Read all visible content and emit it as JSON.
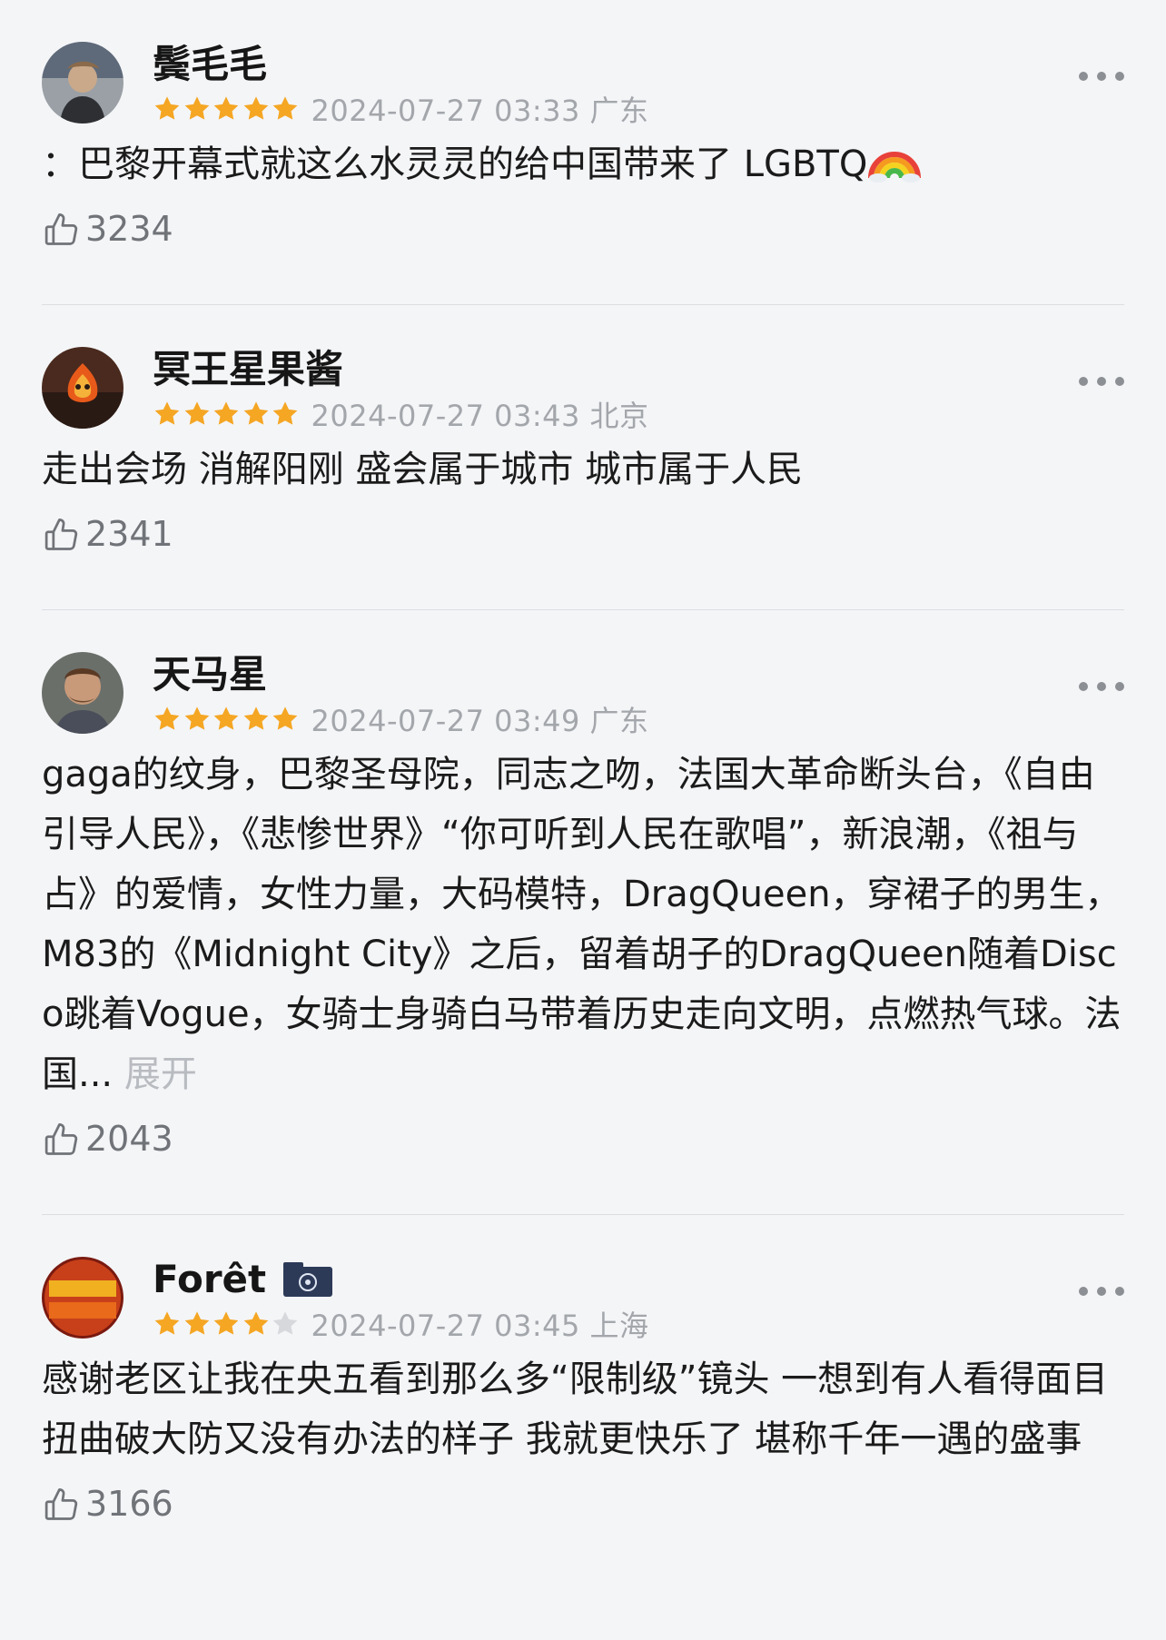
{
  "reviews": [
    {
      "username": "鬓毛毛",
      "rating": 5,
      "datetime": "2024-07-27 03:33",
      "location": "广东",
      "text": "：巴黎开幕式就这么水灵灵的给中国带来了 LGBTQ",
      "emoji": "rainbow-emoji",
      "likes": "3234"
    },
    {
      "username": "冥王星果酱",
      "rating": 5,
      "datetime": "2024-07-27 03:43",
      "location": "北京",
      "text": "走出会场 消解阳刚 盛会属于城市 城市属于人民",
      "likes": "2341"
    },
    {
      "username": "天马星",
      "rating": 5,
      "datetime": "2024-07-27 03:49",
      "location": "广东",
      "text": "gaga的纹身，巴黎圣母院，同志之吻，法国大革命断头台，《自由引导人民》，《悲惨世界》“你可听到人民在歌唱”，新浪潮，《祖与占》的爱情，女性力量，大码模特，DragQueen，穿裙子的男生，M83的《Midnight City》之后，留着胡子的DragQueen随着Disco跳着Vogue，女骑士身骑白马带着历史走向文明，点燃热气球。法国...",
      "expand_label": "展开",
      "likes": "2043"
    },
    {
      "username": "Forêt",
      "rating": 4,
      "datetime": "2024-07-27 03:45",
      "location": "上海",
      "text": "感谢老区让我在央五看到那么多“限制级”镜头 一想到有人看得面目扭曲破大防又没有办法的样子 我就更快乐了 堪称千年一遇的盛事",
      "likes": "3166"
    }
  ],
  "colors": {
    "star": "#f5a623",
    "star_empty": "#d6d8dc",
    "meta": "#a3a6ab",
    "background": "#f4f5f7"
  }
}
